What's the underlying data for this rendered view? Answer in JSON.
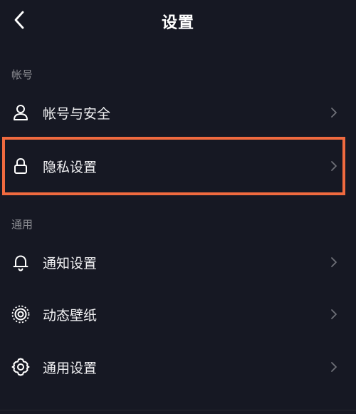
{
  "header": {
    "title": "设置",
    "back_icon": "chevron-left-icon"
  },
  "sections": [
    {
      "label": "帐号",
      "items": [
        {
          "label": "帐号与安全",
          "icon": "user-icon"
        },
        {
          "label": "隐私设置",
          "icon": "lock-icon",
          "highlighted": true
        }
      ]
    },
    {
      "label": "通用",
      "items": [
        {
          "label": "通知设置",
          "icon": "bell-icon"
        },
        {
          "label": "动态壁纸",
          "icon": "live-wallpaper-icon"
        },
        {
          "label": "通用设置",
          "icon": "gear-icon"
        }
      ]
    }
  ],
  "colors": {
    "background": "#161823",
    "text": "#f2f2f4",
    "section_label": "#8a8b91",
    "chevron": "#6f7078",
    "highlight": "#f06a3f"
  }
}
